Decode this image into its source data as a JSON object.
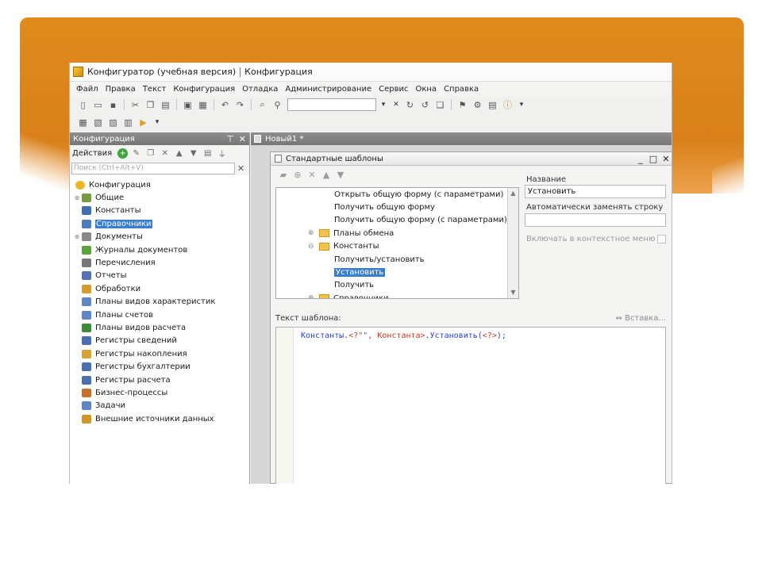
{
  "app": {
    "title": "Конфигуратор (учебная версия)",
    "subtitle": "Конфигурация"
  },
  "menu": [
    "Файл",
    "Правка",
    "Текст",
    "Конфигурация",
    "Отладка",
    "Администрирование",
    "Сервис",
    "Окна",
    "Справка"
  ],
  "left_panel": {
    "title": "Конфигурация",
    "actions_label": "Действия",
    "search_placeholder": "Поиск (Ctrl+Alt+V)",
    "tree": [
      {
        "label": "Конфигурация",
        "icon": "configuration-icon",
        "color": "#f0b429",
        "level": 0,
        "expander": ""
      },
      {
        "label": "Общие",
        "icon": "common-icon",
        "color": "#7a9b3c",
        "level": 1,
        "expander": "⊕"
      },
      {
        "label": "Константы",
        "icon": "constants-icon",
        "color": "#3f6fb2",
        "level": 1,
        "expander": ""
      },
      {
        "label": "Справочники",
        "icon": "catalogs-icon",
        "color": "#4b7cc0",
        "level": 1,
        "expander": "",
        "selected": true
      },
      {
        "label": "Документы",
        "icon": "documents-icon",
        "color": "#8a8a8a",
        "level": 1,
        "expander": "⊕"
      },
      {
        "label": "Журналы документов",
        "icon": "document-journals-icon",
        "color": "#5ea23a",
        "level": 1,
        "expander": ""
      },
      {
        "label": "Перечисления",
        "icon": "enumerations-icon",
        "color": "#777777",
        "level": 1,
        "expander": ""
      },
      {
        "label": "Отчеты",
        "icon": "reports-icon",
        "color": "#5472b5",
        "level": 1,
        "expander": ""
      },
      {
        "label": "Обработки",
        "icon": "data-processors-icon",
        "color": "#d59c2a",
        "level": 1,
        "expander": ""
      },
      {
        "label": "Планы видов характеристик",
        "icon": "chart-of-characteristic-types-icon",
        "color": "#5f86c4",
        "level": 1,
        "expander": ""
      },
      {
        "label": "Планы счетов",
        "icon": "chart-of-accounts-icon",
        "color": "#5f86c4",
        "level": 1,
        "expander": ""
      },
      {
        "label": "Планы видов расчета",
        "icon": "chart-of-calculation-types-icon",
        "color": "#3f8a3a",
        "level": 1,
        "expander": ""
      },
      {
        "label": "Регистры сведений",
        "icon": "information-registers-icon",
        "color": "#4a6fb0",
        "level": 1,
        "expander": ""
      },
      {
        "label": "Регистры накопления",
        "icon": "accumulation-registers-icon",
        "color": "#d6a233",
        "level": 1,
        "expander": ""
      },
      {
        "label": "Регистры бухгалтерии",
        "icon": "accounting-registers-icon",
        "color": "#4a6fb0",
        "level": 1,
        "expander": ""
      },
      {
        "label": "Регистры расчета",
        "icon": "calculation-registers-icon",
        "color": "#4a6fb0",
        "level": 1,
        "expander": ""
      },
      {
        "label": "Бизнес-процессы",
        "icon": "business-processes-icon",
        "color": "#c86f2a",
        "level": 1,
        "expander": ""
      },
      {
        "label": "Задачи",
        "icon": "tasks-icon",
        "color": "#5f86c4",
        "level": 1,
        "expander": ""
      },
      {
        "label": "Внешние источники данных",
        "icon": "external-data-sources-icon",
        "color": "#d1962a",
        "level": 1,
        "expander": ""
      }
    ]
  },
  "doc_tab": {
    "label": "Новый1 *"
  },
  "dialog": {
    "title": "Стандартные шаблоны",
    "tree": [
      {
        "label": "Открыть общую форму (с параметрами)",
        "type": "item",
        "level": 2
      },
      {
        "label": "Получить общую форму",
        "type": "item",
        "level": 2
      },
      {
        "label": "Получить общую форму (с параметрами)",
        "type": "item",
        "level": 2
      },
      {
        "label": "Планы обмена",
        "type": "folder",
        "level": 1,
        "expander": "⊕"
      },
      {
        "label": "Константы",
        "type": "folder",
        "level": 1,
        "expander": "⊖"
      },
      {
        "label": "Получить/установить",
        "type": "item",
        "level": 2
      },
      {
        "label": "Установить",
        "type": "item",
        "level": 2,
        "selected": true
      },
      {
        "label": "Получить",
        "type": "item",
        "level": 2
      },
      {
        "label": "Справочники",
        "type": "folder",
        "level": 1,
        "expander": "⊕"
      }
    ],
    "name_label": "Название",
    "name_value": "Установить",
    "auto_replace_label": "Автоматически заменять строку",
    "auto_replace_value": "",
    "context_menu_label": "Включать в контекстное меню",
    "template_text_label": "Текст шаблона:",
    "insert_link": "Вставка...",
    "code": {
      "part1": "Константы.",
      "part2": "<?\"\", Константа>",
      "part3": ".Установить(",
      "part4": "<?>",
      "part5": ");"
    }
  },
  "colors": {
    "accent_orange": "#dc861b",
    "selection": "#3a7ecb",
    "panel_header": "#808080"
  }
}
